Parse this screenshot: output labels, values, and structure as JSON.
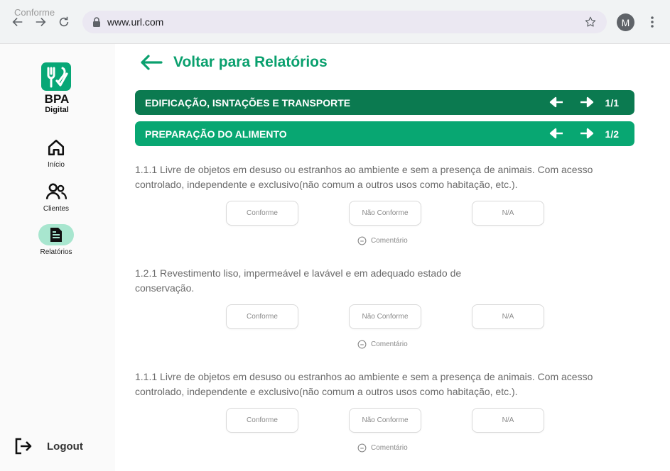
{
  "browser": {
    "ghost_tab_title": "Conforme",
    "url": "www.url.com",
    "avatar_letter": "M"
  },
  "sidebar": {
    "logo_title": "BPA",
    "logo_subtitle": "Digital",
    "items": [
      {
        "label": "Início",
        "icon": "home-icon"
      },
      {
        "label": "Clientes",
        "icon": "users-icon"
      },
      {
        "label": "Relatórios",
        "icon": "document-icon",
        "active": true
      }
    ],
    "logout_label": "Logout"
  },
  "main": {
    "back_label": "Voltar para Relatórios",
    "sections": [
      {
        "title": "EDIFICAÇÃO, ISNTAÇÕES E TRANSPORTE",
        "count": "1/1",
        "color": "#0b7a50"
      },
      {
        "title": "PREPARAÇÃO DO ALIMENTO",
        "count": "1/2",
        "color": "#08a772"
      }
    ],
    "questions": [
      {
        "text": "1.1.1 Livre de objetos em desuso ou estranhos ao ambiente e sem a presença de animais. Com acesso controlado, independente e exclusivo(não comum a outros usos como habitação, etc.)."
      },
      {
        "text": "1.2.1 Revestimento liso, impermeável e lavável e em adequado estado de conservação."
      },
      {
        "text": "1.1.1 Livre de objetos em desuso ou estranhos ao ambiente e sem a presença de animais. Com acesso controlado, independente e exclusivo(não comum a outros usos como habitação, etc.)."
      }
    ],
    "options": {
      "conforme": "Conforme",
      "nao_conforme": "Não Conforme",
      "na": "N/A"
    },
    "comment_label": "Comentário"
  },
  "colors": {
    "accent": "#0aa06e",
    "dark_green": "#0b7a50",
    "active_pill": "#a8e6cf"
  }
}
